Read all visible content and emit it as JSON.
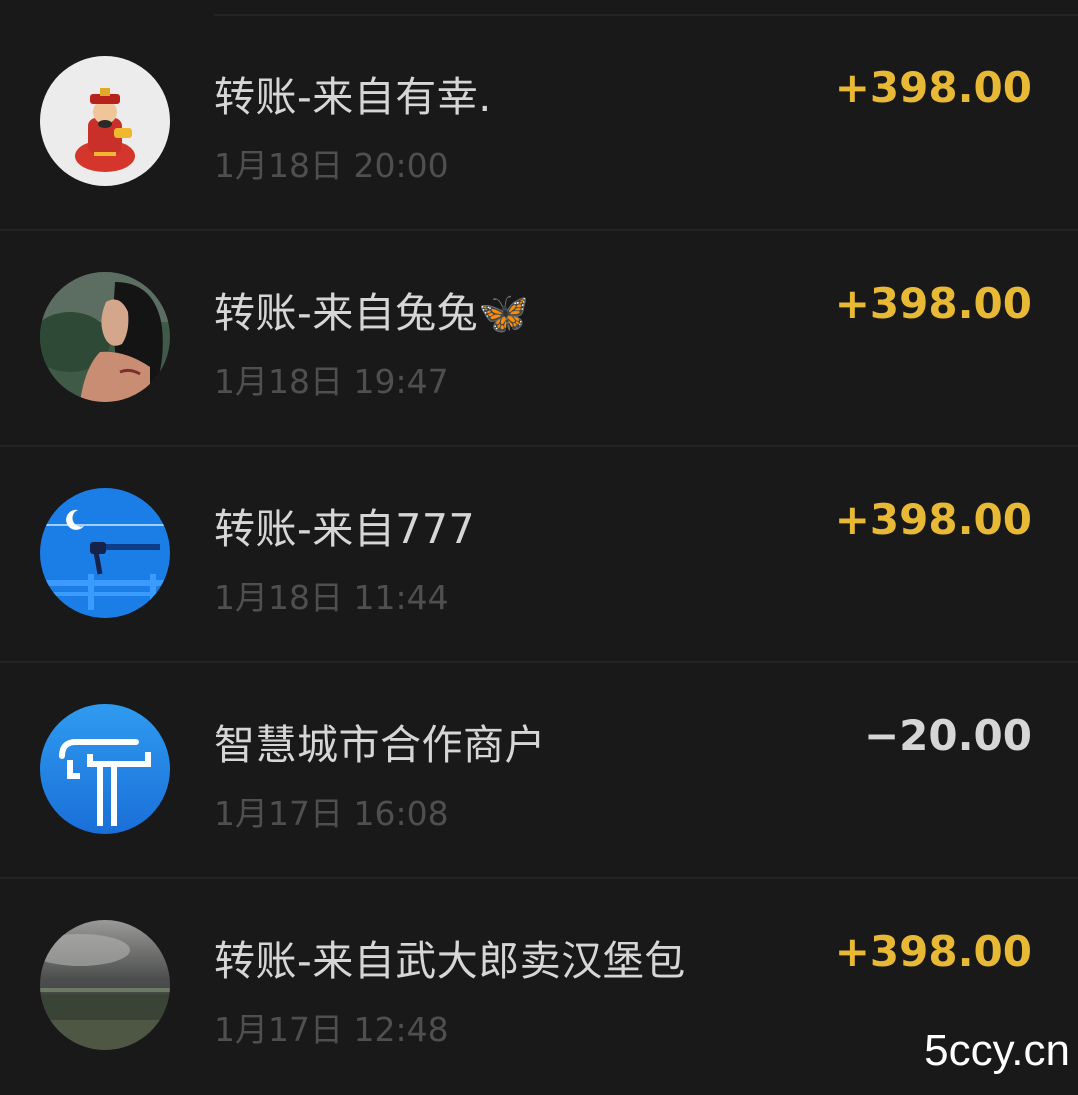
{
  "transactions": [
    {
      "title": "转账-来自有幸.",
      "time": "1月18日 20:00",
      "amount": "+398.00",
      "direction": "income",
      "avatar_icon": "caishen-avatar"
    },
    {
      "title": "转账-来自兔兔🦋",
      "time": "1月18日 19:47",
      "amount": "+398.00",
      "direction": "income",
      "avatar_icon": "woman-portrait-avatar"
    },
    {
      "title": "转账-来自777",
      "time": "1月18日 11:44",
      "amount": "+398.00",
      "direction": "income",
      "avatar_icon": "moon-night-avatar"
    },
    {
      "title": "智慧城市合作商户",
      "time": "1月17日 16:08",
      "amount": "−20.00",
      "direction": "expense",
      "avatar_icon": "smart-city-logo-avatar"
    },
    {
      "title": "转账-来自武大郎卖汉堡包",
      "time": "1月17日 12:48",
      "amount": "+398.00",
      "direction": "income",
      "avatar_icon": "cloudy-landscape-avatar"
    }
  ],
  "watermark": "5ccy.cn",
  "colors": {
    "background": "#191919",
    "income": "#e8b934",
    "expense": "#d6d6d6",
    "title": "#d6d6d6",
    "time": "#4f4f4f"
  }
}
